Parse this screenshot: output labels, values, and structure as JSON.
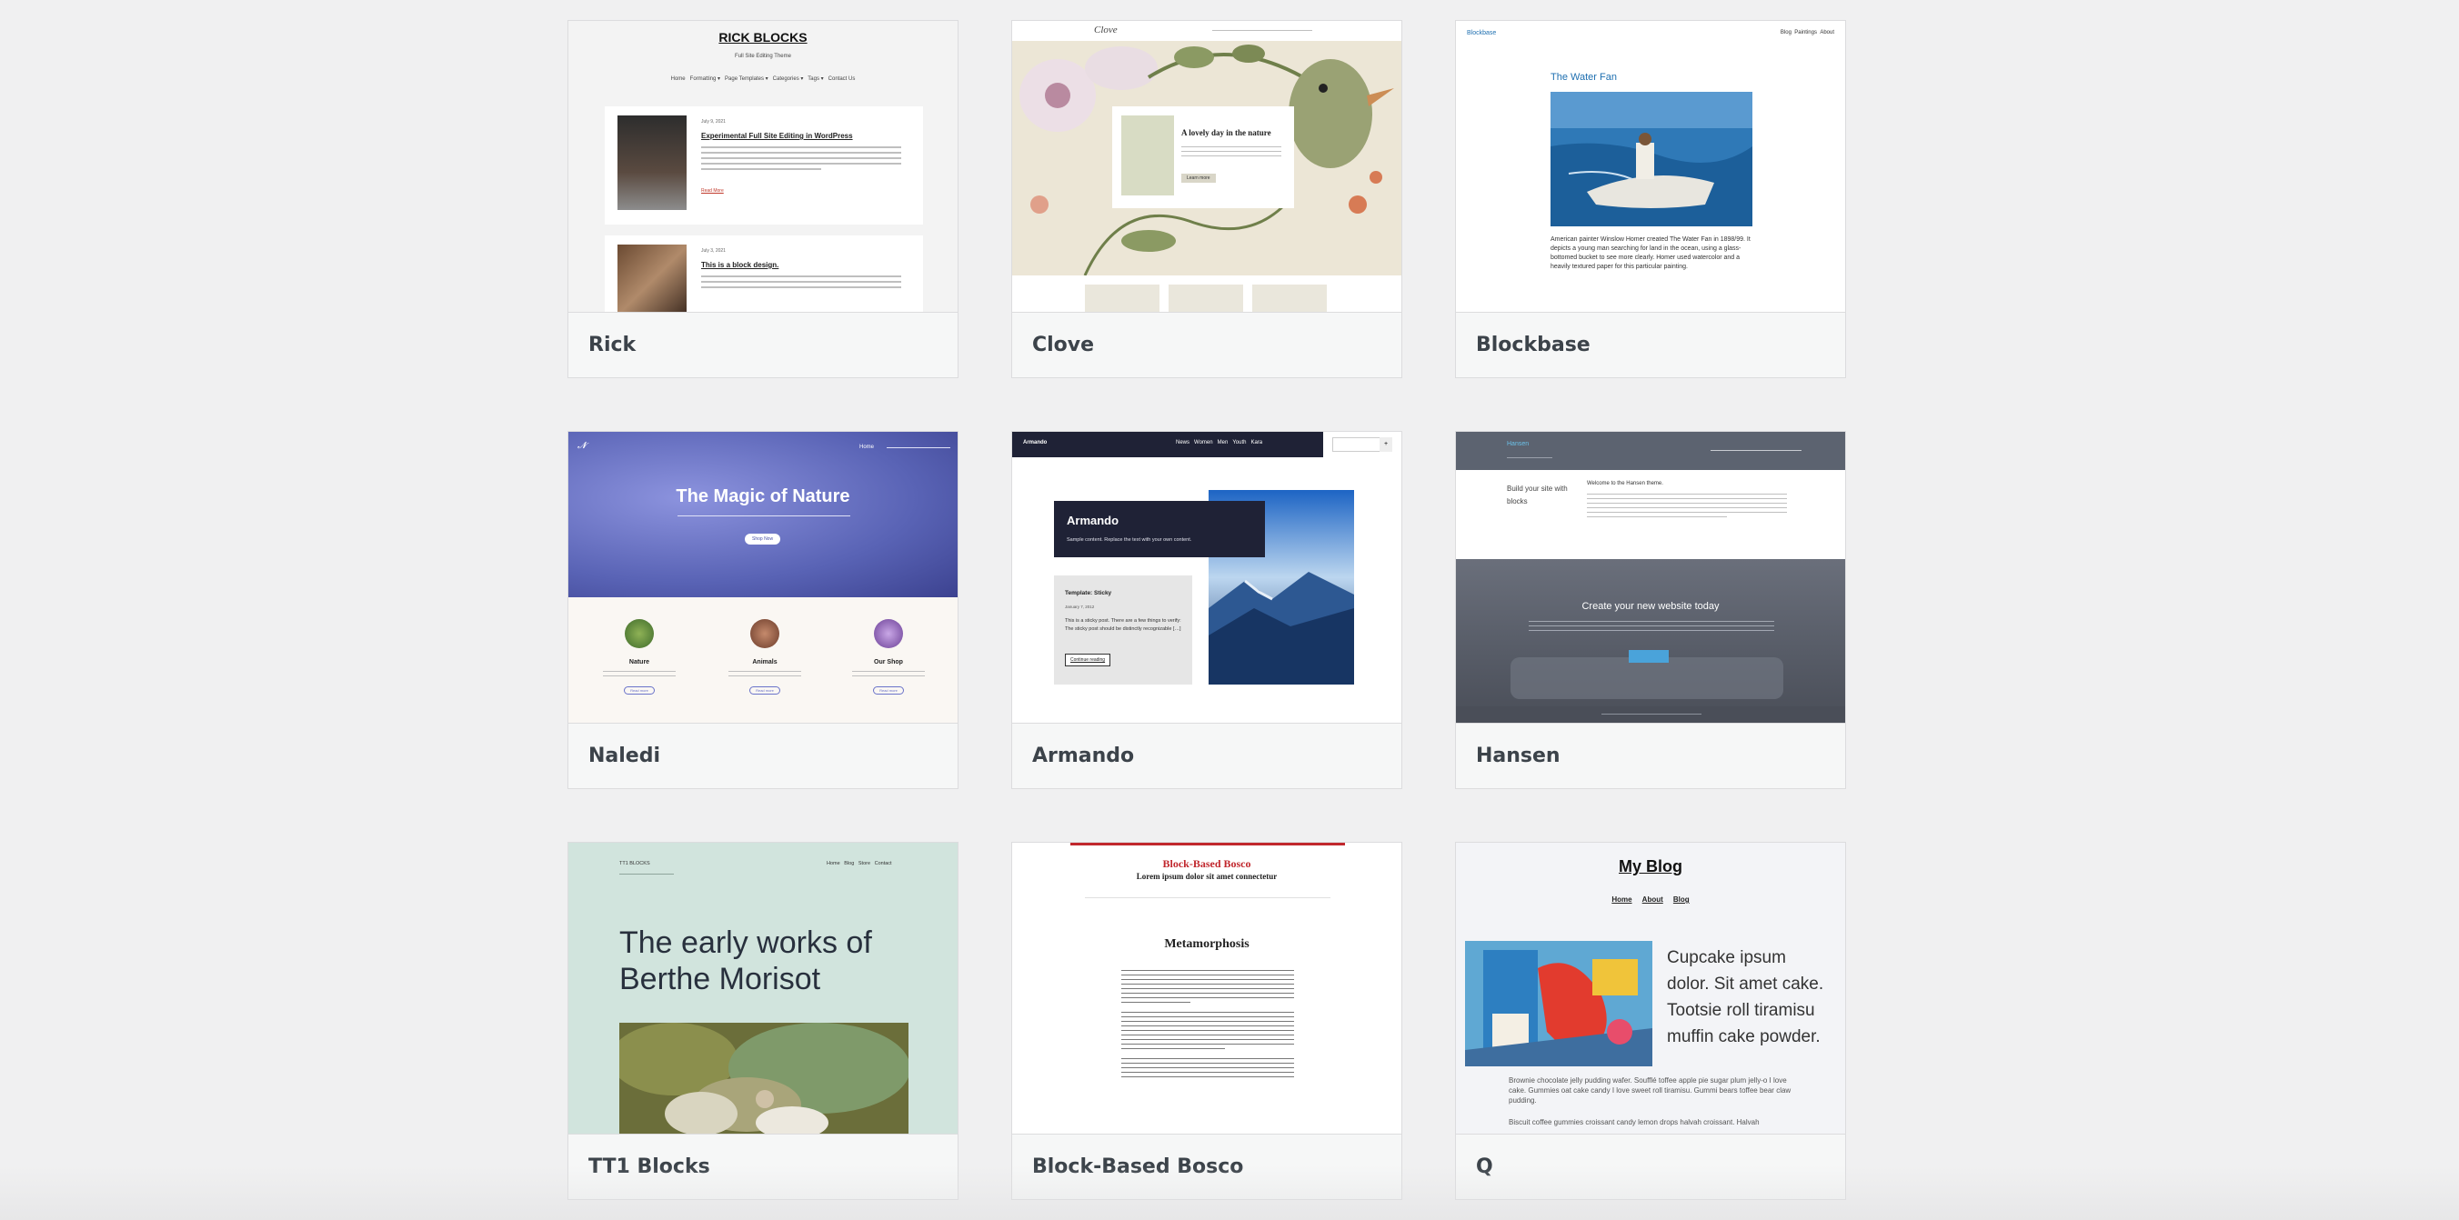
{
  "themes": [
    {
      "name": "Rick"
    },
    {
      "name": "Clove"
    },
    {
      "name": "Blockbase"
    },
    {
      "name": "Naledi"
    },
    {
      "name": "Armando"
    },
    {
      "name": "Hansen"
    },
    {
      "name": "TT1 Blocks"
    },
    {
      "name": "Block-Based Bosco"
    },
    {
      "name": "Q"
    }
  ],
  "previews": {
    "rick": {
      "site_title": "RICK BLOCKS",
      "tagline": "Full Site Editing Theme",
      "nav": [
        "Home",
        "Formatting ▾",
        "Page Templates ▾",
        "Categories ▾",
        "Tags ▾",
        "Contact Us"
      ],
      "post1_date": "July 9, 2021",
      "post1_title": "Experimental Full Site Editing in WordPress",
      "post1_more": "Read More",
      "post2_date": "July 3, 2021",
      "post2_title": "This is a block design."
    },
    "clove": {
      "logo": "Clove",
      "heading": "A lovely day in the nature",
      "button": "Learn more"
    },
    "blockbase": {
      "site": "Blockbase",
      "nav": [
        "Blog",
        "Paintings",
        "About"
      ],
      "title": "The Water Fan",
      "caption": "American painter Winslow Homer created The Water Fan in 1898/99. It depicts a young man searching for land in the ocean, using a glass-bottomed bucket to see more clearly. Homer used watercolor and a heavily textured paper for this particular painting."
    },
    "naledi": {
      "hero": "The Magic of Nature",
      "hero_btn": "Shop Now",
      "nav_home": "Home",
      "cols": [
        {
          "title": "Nature",
          "btn": "Read more"
        },
        {
          "title": "Animals",
          "btn": "Read more"
        },
        {
          "title": "Our Shop",
          "btn": "Read more"
        }
      ]
    },
    "armando": {
      "site": "Armando",
      "nav": [
        "News",
        "Women",
        "Men",
        "Youth",
        "Kara"
      ],
      "box_title": "Armando",
      "box_text": "Sample content. Replace the text with your own content.",
      "sticky_title": "Template: Sticky",
      "sticky_date": "January 7, 2012",
      "sticky_text": "This is a sticky post. There are a few things to verify: The sticky post should be distinctly recognizable […]",
      "sticky_link": "Continue reading"
    },
    "hansen": {
      "site": "Hansen",
      "welcome": "Welcome to the Hansen theme.",
      "build": "Build your site with blocks",
      "banner": "Create your new website today"
    },
    "tt1": {
      "site": "TT1 BLOCKS",
      "nav": [
        "Home",
        "Blog",
        "Store",
        "Contact"
      ],
      "heading_line1": "The early works of",
      "heading_line2": "Berthe Morisot"
    },
    "bosco": {
      "title": "Block-Based Bosco",
      "subtitle": "Lorem ipsum dolor sit amet connectetur",
      "post_title": "Metamorphosis"
    },
    "q": {
      "title": "My Blog",
      "nav": [
        "Home",
        "About",
        "Blog"
      ],
      "text": "Cupcake ipsum dolor. Sit amet cake. Tootsie roll tiramisu muffin cake powder.",
      "para1": "Brownie chocolate jelly pudding wafer. Soufflé toffee apple pie sugar plum jelly-o I love cake. Gummies oat cake candy I love sweet roll tiramisu. Gummi bears toffee bear claw pudding.",
      "para2": "Biscuit coffee gummies croissant candy lemon drops halvah croissant. Halvah"
    }
  },
  "colors": {
    "page_bg": "#f0f0f1",
    "card_border": "#dcdcde",
    "name_bar": "#f6f7f7",
    "armando_navy": "#1f2236",
    "bosco_red": "#c1272d",
    "naledi_purple": "#6a73c9"
  }
}
